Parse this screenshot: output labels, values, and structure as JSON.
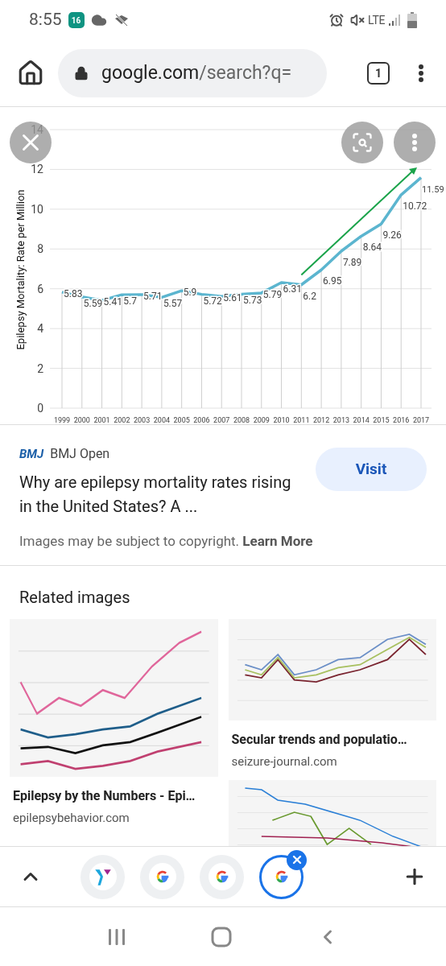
{
  "status_bar": {
    "time": "8:55",
    "calendar_day": "16",
    "network": "LTE"
  },
  "browser": {
    "url_host": "google.com",
    "url_path": "/search?q=",
    "tab_count": "1"
  },
  "viewer": {
    "chart_data": {
      "type": "line",
      "ylabel": "Epilepsy Mortality: Rate per Million",
      "categories": [
        "1999",
        "2000",
        "2001",
        "2002",
        "2003",
        "2004",
        "2005",
        "2006",
        "2007",
        "2008",
        "2009",
        "2010",
        "2011",
        "2012",
        "2013",
        "2014",
        "2015",
        "2016",
        "2017"
      ],
      "values": [
        5.83,
        5.59,
        5.41,
        5.7,
        5.71,
        5.57,
        5.9,
        5.72,
        5.61,
        5.73,
        5.79,
        6.31,
        6.2,
        6.95,
        7.89,
        8.64,
        9.26,
        10.72,
        11.59
      ],
      "ylim": [
        0,
        14
      ],
      "yticks": [
        0,
        2,
        4,
        6,
        8,
        10,
        12,
        14
      ],
      "data_labels": true,
      "grid": true
    }
  },
  "result": {
    "source": "BMJ Open",
    "source_logo": "BMJ",
    "title": "Why are epilepsy mortality rates rising in the United States? A ...",
    "visit": "Visit",
    "notice": "Images may be subject to copyright.",
    "notice_link": "Learn More"
  },
  "related": {
    "heading": "Related images",
    "columns": [
      [
        {
          "title": "Epilepsy by the Numbers - Epi…",
          "source": "epilepsybehavior.com"
        }
      ],
      [
        {
          "title": "Secular trends and populatio…",
          "source": "seizure-journal.com"
        },
        {
          "kind": "picture"
        }
      ]
    ]
  },
  "tab_strip": {
    "tabs": [
      {
        "kind": "ymca",
        "selected": false
      },
      {
        "kind": "google",
        "selected": false
      },
      {
        "kind": "google",
        "selected": false
      },
      {
        "kind": "google",
        "selected": true
      }
    ]
  }
}
